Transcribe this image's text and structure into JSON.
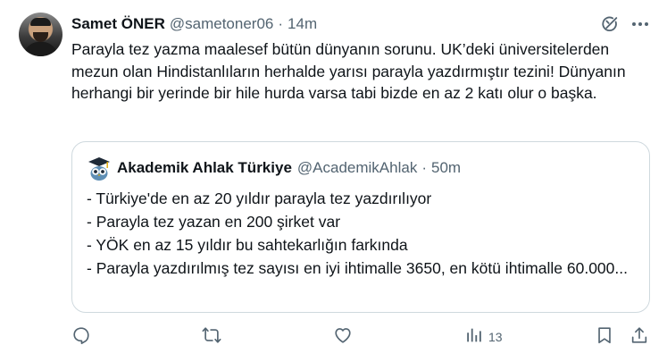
{
  "tweet": {
    "author_name": "Samet ÖNER",
    "author_handle": "@sametoner06",
    "separator": "·",
    "time": "14m",
    "text": "Parayla tez yazma maalesef bütün dünyanın sorunu. UK’deki üniversitelerden mezun olan Hindistanlıların herhalde yarısı parayla yazdırmıştır tezini! Dünyanın herhangi bir yerinde bir hile hurda varsa tabi bizde en az 2 katı olur o başka."
  },
  "quote": {
    "author_name": "Akademik Ahlak Türkiye",
    "author_handle": "@AcademikAhlak",
    "separator": "·",
    "time": "50m",
    "lines": [
      "- Türkiye'de en az 20 yıldır parayla tez yazdırılıyor",
      "- Parayla tez yazan en 200 şirket var",
      "- YÖK en az 15 yıldır bu sahtekarlığın farkında",
      "- Parayla yazdırılmış tez sayısı en iyi ihtimalle 3650, en kötü ihtimalle 60.000..."
    ]
  },
  "actions": {
    "views_count": "13"
  },
  "icons": {
    "header": [
      "grok-icon",
      "more-icon"
    ],
    "actions": [
      "reply-icon",
      "retweet-icon",
      "like-icon",
      "views-icon",
      "bookmark-icon",
      "share-icon"
    ],
    "quote_avatar": "owl-graduate-icon"
  },
  "colors": {
    "text_primary": "#0f1419",
    "text_secondary": "#536471",
    "border": "#cfd9de",
    "background": "#ffffff"
  }
}
